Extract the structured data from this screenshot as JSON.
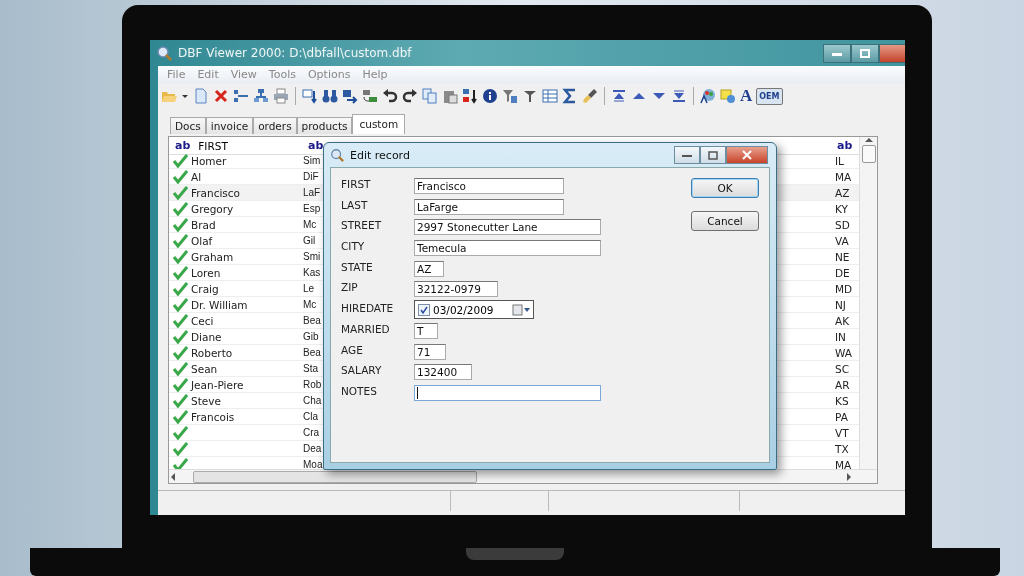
{
  "window": {
    "title": "DBF Viewer 2000: D:\\dbfall\\custom.dbf"
  },
  "menu": [
    "File",
    "Edit",
    "View",
    "Tools",
    "Options",
    "Help"
  ],
  "toolbar": {
    "font_glyph": "A",
    "oem_button": {
      "label": "OEM",
      "on": true
    }
  },
  "tabs": [
    {
      "label": "Docs",
      "selected": false
    },
    {
      "label": "invoice",
      "selected": false
    },
    {
      "label": "orders",
      "selected": false
    },
    {
      "label": "products",
      "selected": false
    },
    {
      "label": "custom",
      "selected": true
    }
  ],
  "table": {
    "columns": [
      {
        "type": "ab",
        "title": "FIRST"
      },
      {
        "type": "ab"
      },
      {
        "type": "ab"
      }
    ],
    "rows": [
      {
        "first": "Homer",
        "column_2": "Sim",
        "column_3": "IL",
        "selected": false
      },
      {
        "first": "Al",
        "column_2": "DiF",
        "column_3": "MA",
        "selected": false
      },
      {
        "first": "Francisco",
        "column_2": "LaF",
        "column_3": "AZ",
        "selected": true
      },
      {
        "first": "Gregory",
        "column_2": "Esp",
        "column_3": "KY",
        "selected": false
      },
      {
        "first": "Brad",
        "column_2": "Mc",
        "column_3": "SD",
        "selected": false
      },
      {
        "first": "Olaf",
        "column_2": "Gil",
        "column_3": "VA",
        "selected": false
      },
      {
        "first": "Graham",
        "column_2": "Smi",
        "column_3": "NE",
        "selected": false
      },
      {
        "first": "Loren",
        "column_2": "Kas",
        "column_3": "DE",
        "selected": false
      },
      {
        "first": "Craig",
        "column_2": "Le",
        "column_3": "MD",
        "selected": false
      },
      {
        "first": "Dr. William",
        "column_2": "Mc",
        "column_3": "NJ",
        "selected": false
      },
      {
        "first": "Ceci",
        "column_2": "Bea",
        "column_3": "AK",
        "selected": false
      },
      {
        "first": "Diane",
        "column_2": "Gib",
        "column_3": "IN",
        "selected": false
      },
      {
        "first": "Roberto",
        "column_2": "Bea",
        "column_3": "WA",
        "selected": false
      },
      {
        "first": "Sean",
        "column_2": "Sta",
        "column_3": "SC",
        "selected": false
      },
      {
        "first": "Jean-Piere",
        "column_2": "Rob",
        "column_3": "AR",
        "selected": false
      },
      {
        "first": "Steve",
        "column_2": "Cha",
        "column_3": "KS",
        "selected": false
      },
      {
        "first": "Francois",
        "column_2": "Cla",
        "column_3": "PA",
        "selected": false
      },
      {
        "column_2": "Cra",
        "column_3": "VT",
        "selected": false
      },
      {
        "column_2": "Dea",
        "column_3": "TX",
        "selected": false
      },
      {
        "column_2": "Moa",
        "column_3": "MA",
        "selected": false
      }
    ]
  },
  "dialog": {
    "title": "Edit record",
    "fields": [
      {
        "label": "FIRST",
        "kind": "text",
        "value": "Francisco",
        "focused": false
      },
      {
        "label": "LAST",
        "kind": "text",
        "value": "LaFarge",
        "focused": false
      },
      {
        "label": "STREET",
        "kind": "text",
        "value": "2997 Stonecutter Lane",
        "focused": false
      },
      {
        "label": "CITY",
        "kind": "text",
        "value": "Temecula",
        "focused": false
      },
      {
        "label": "STATE",
        "kind": "text",
        "value": "AZ",
        "focused": false
      },
      {
        "label": "ZIP",
        "kind": "text",
        "value": "32122-0979",
        "focused": false
      },
      {
        "label": "HIREDATE",
        "kind": "date",
        "value": "03/02/2009",
        "checked": true,
        "focused": false
      },
      {
        "label": "MARRIED",
        "kind": "text",
        "value": "T",
        "focused": false
      },
      {
        "label": "AGE",
        "kind": "text",
        "value": "71",
        "focused": false
      },
      {
        "label": "SALARY",
        "kind": "text",
        "value": "132400",
        "focused": false
      },
      {
        "label": "NOTES",
        "kind": "text",
        "focused": true
      }
    ],
    "buttons": [
      {
        "label": "OK",
        "default": true
      },
      {
        "label": "Cancel",
        "default": false
      }
    ]
  }
}
